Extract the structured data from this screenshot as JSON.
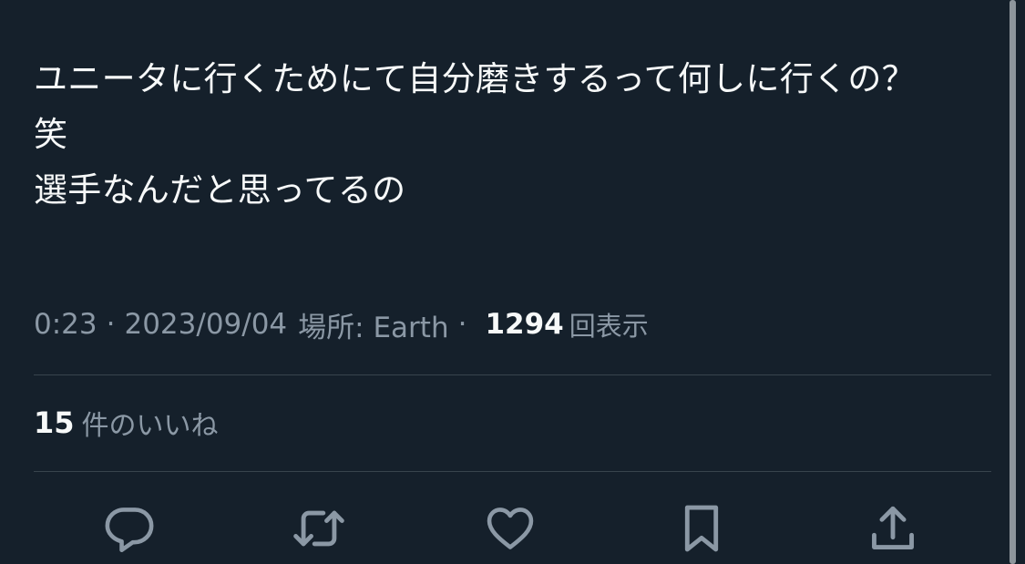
{
  "tweet": {
    "lines": [
      "ユニータに行くためにて自分磨きするって何しに行くの？",
      "笑",
      "選手なんだと思ってるの"
    ],
    "meta": {
      "time": "0:23",
      "separator": "·",
      "date": "2023/09/04",
      "location_label": "場所: Earth",
      "views_count": "1294",
      "views_label": "回表示"
    },
    "likes": {
      "count": "15",
      "label": "件のいいね"
    }
  },
  "actions": [
    {
      "name": "reply",
      "icon": "reply-icon"
    },
    {
      "name": "retweet",
      "icon": "retweet-icon"
    },
    {
      "name": "like",
      "icon": "heart-icon"
    },
    {
      "name": "bookmark",
      "icon": "bookmark-icon"
    },
    {
      "name": "share",
      "icon": "share-icon"
    }
  ],
  "colors": {
    "background": "#15202b",
    "text": "#f7f9f9",
    "muted": "#8b98a5",
    "divider": "#38444d"
  }
}
